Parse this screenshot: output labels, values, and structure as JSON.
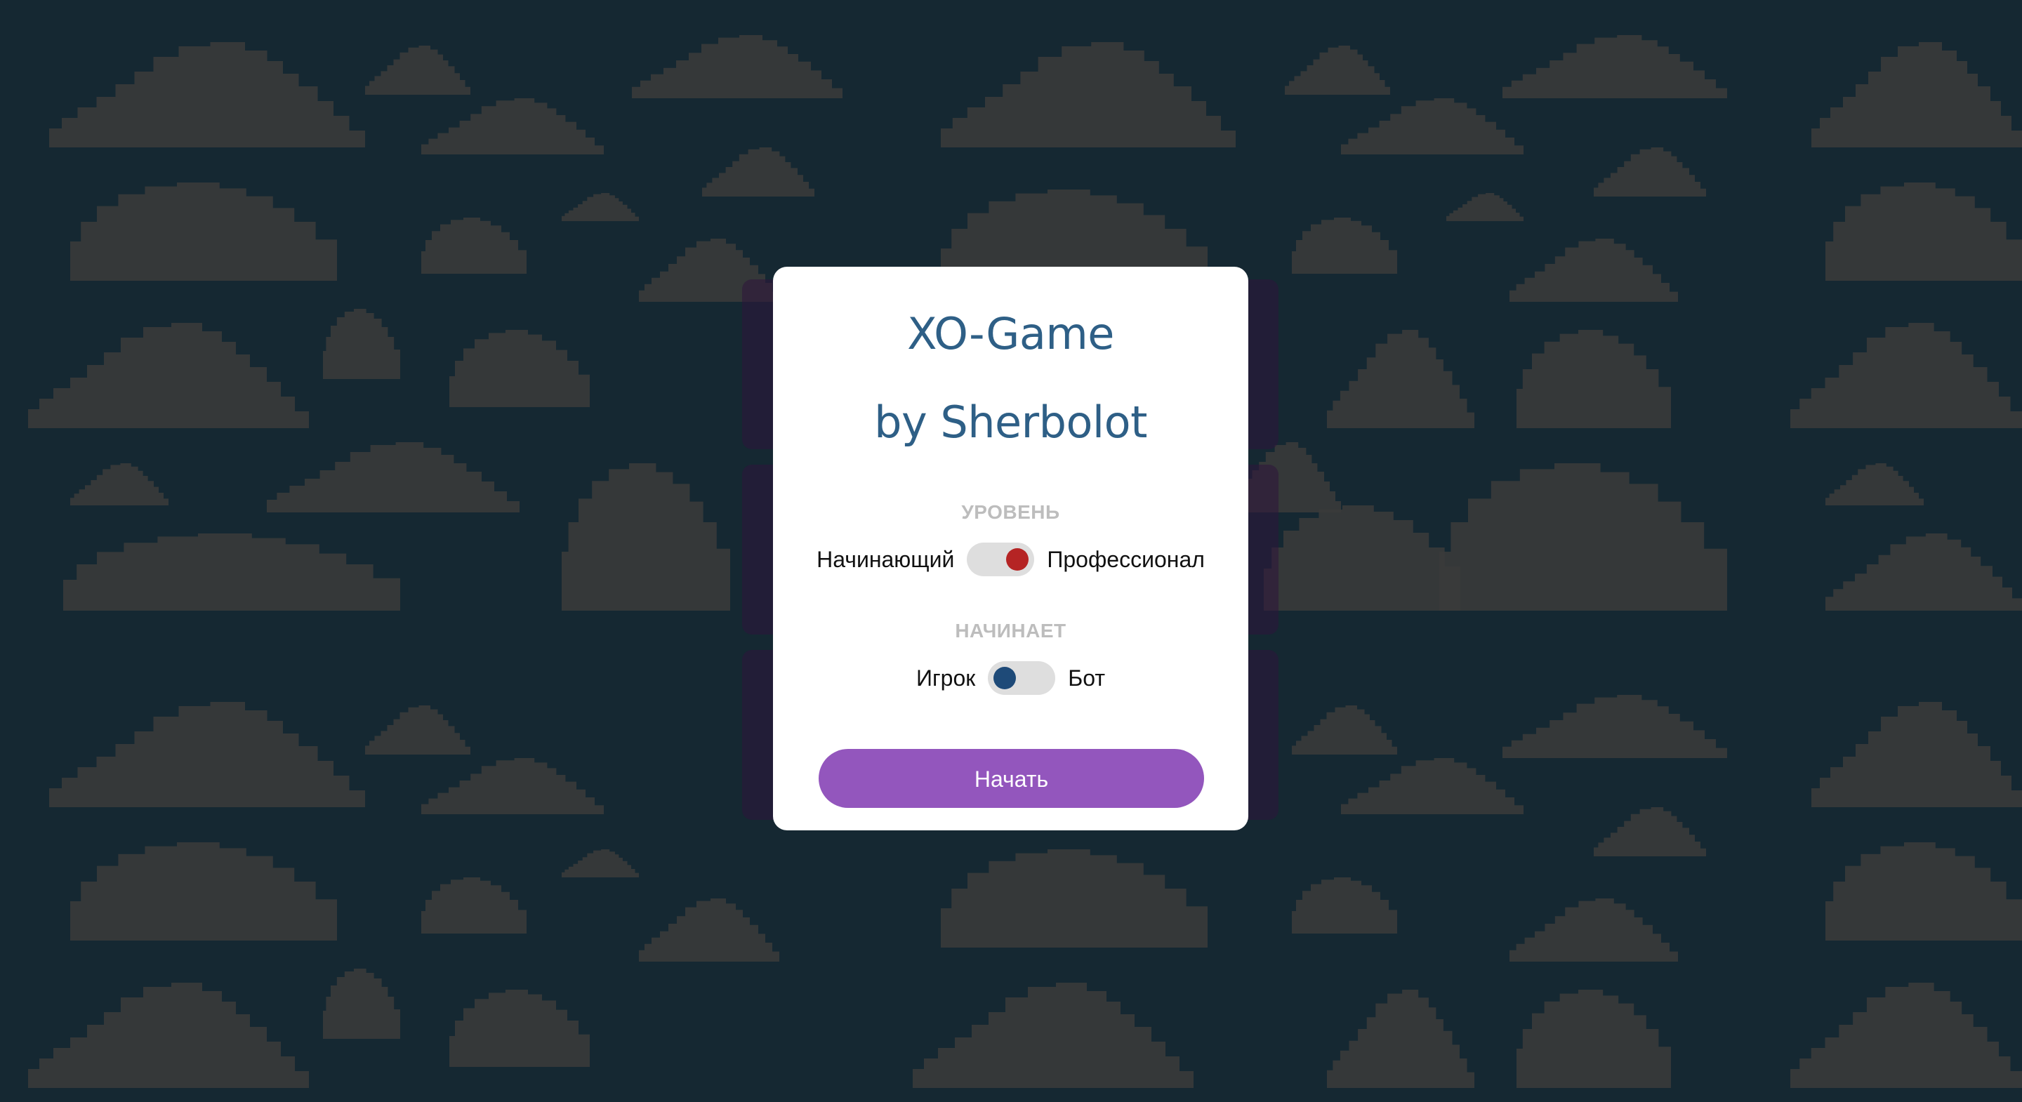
{
  "app": {
    "title_line1": "XO-Game",
    "title_line2": "by Sherbolot"
  },
  "level": {
    "label": "УРОВЕНЬ",
    "left_option": "Начинающий",
    "right_option": "Профессионал",
    "selected": "Профессионал"
  },
  "first_move": {
    "label": "НАЧИНАЕТ",
    "left_option": "Игрок",
    "right_option": "Бот",
    "selected": "Игрок"
  },
  "start_button": {
    "label": "Начать"
  },
  "colors": {
    "background": "#152832",
    "cloud": "#3a3a3a",
    "title": "#2e5f86",
    "level_knob": "#b52424",
    "first_move_knob": "#1e4a78",
    "button": "#9356bd"
  }
}
